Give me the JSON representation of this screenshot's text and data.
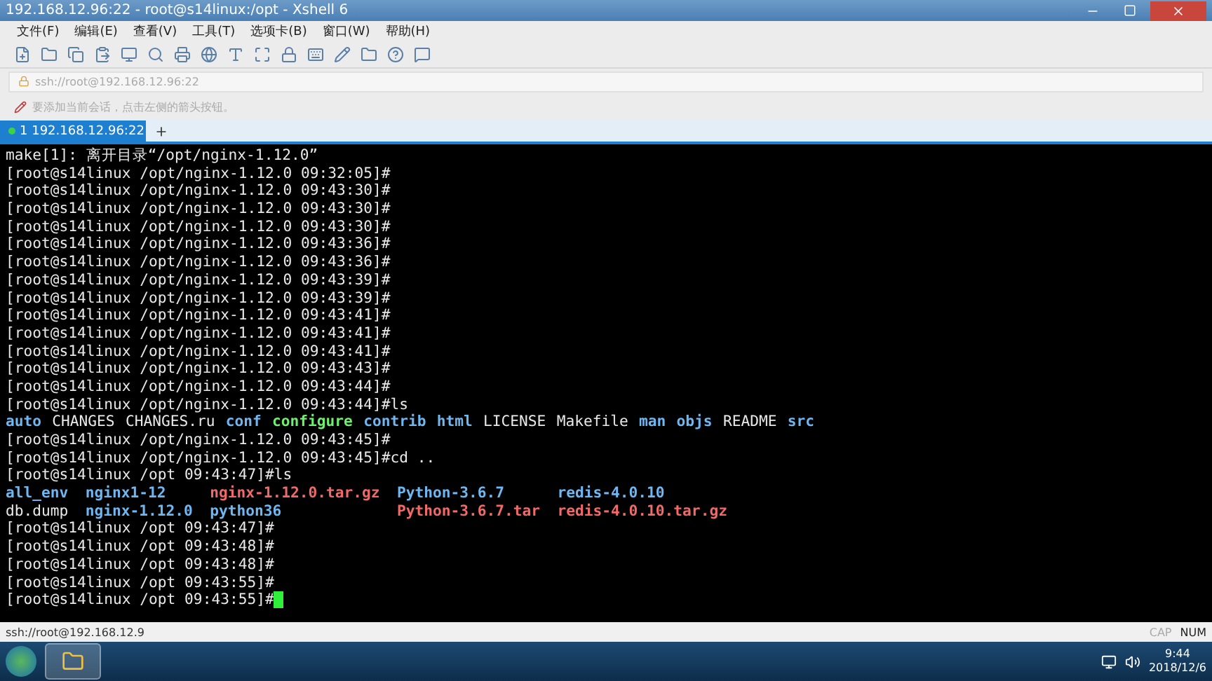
{
  "window": {
    "title": "192.168.12.96:22 - root@s14linux:/opt - Xshell 6"
  },
  "menu": [
    "文件(F)",
    "编辑(E)",
    "查看(V)",
    "工具(T)",
    "选项卡(B)",
    "窗口(W)",
    "帮助(H)"
  ],
  "address": {
    "value": "ssh://root@192.168.12.96:22"
  },
  "hint": "要添加当前会话，点击左侧的箭头按钮。",
  "tabs": [
    {
      "label": "1 192.168.12.96:22",
      "selected": true,
      "connected": true
    }
  ],
  "terminal": {
    "lines": [
      {
        "kind": "text",
        "text": "make[1]: 离开目录“/opt/nginx-1.12.0”"
      },
      {
        "kind": "text",
        "text": "[root@s14linux /opt/nginx-1.12.0 09:32:05]#"
      },
      {
        "kind": "text",
        "text": "[root@s14linux /opt/nginx-1.12.0 09:43:30]#"
      },
      {
        "kind": "text",
        "text": "[root@s14linux /opt/nginx-1.12.0 09:43:30]#"
      },
      {
        "kind": "text",
        "text": "[root@s14linux /opt/nginx-1.12.0 09:43:30]#"
      },
      {
        "kind": "text",
        "text": "[root@s14linux /opt/nginx-1.12.0 09:43:36]#"
      },
      {
        "kind": "text",
        "text": "[root@s14linux /opt/nginx-1.12.0 09:43:36]#"
      },
      {
        "kind": "text",
        "text": "[root@s14linux /opt/nginx-1.12.0 09:43:39]#"
      },
      {
        "kind": "text",
        "text": "[root@s14linux /opt/nginx-1.12.0 09:43:39]#"
      },
      {
        "kind": "text",
        "text": "[root@s14linux /opt/nginx-1.12.0 09:43:41]#"
      },
      {
        "kind": "text",
        "text": "[root@s14linux /opt/nginx-1.12.0 09:43:41]#"
      },
      {
        "kind": "text",
        "text": "[root@s14linux /opt/nginx-1.12.0 09:43:41]#"
      },
      {
        "kind": "text",
        "text": "[root@s14linux /opt/nginx-1.12.0 09:43:43]#"
      },
      {
        "kind": "text",
        "text": "[root@s14linux /opt/nginx-1.12.0 09:43:44]#"
      },
      {
        "kind": "text",
        "text": "[root@s14linux /opt/nginx-1.12.0 09:43:44]#ls"
      },
      {
        "kind": "files",
        "files": [
          {
            "name": "auto",
            "kind": "dir"
          },
          {
            "name": "CHANGES",
            "kind": "file"
          },
          {
            "name": "CHANGES.ru",
            "kind": "file"
          },
          {
            "name": "conf",
            "kind": "dir"
          },
          {
            "name": "configure",
            "kind": "exec"
          },
          {
            "name": "contrib",
            "kind": "dir"
          },
          {
            "name": "html",
            "kind": "dir"
          },
          {
            "name": "LICENSE",
            "kind": "file"
          },
          {
            "name": "Makefile",
            "kind": "file"
          },
          {
            "name": "man",
            "kind": "dir"
          },
          {
            "name": "objs",
            "kind": "dir"
          },
          {
            "name": "README",
            "kind": "file"
          },
          {
            "name": "src",
            "kind": "dir"
          }
        ]
      },
      {
        "kind": "text",
        "text": "[root@s14linux /opt/nginx-1.12.0 09:43:45]#"
      },
      {
        "kind": "text",
        "text": "[root@s14linux /opt/nginx-1.12.0 09:43:45]#cd .."
      },
      {
        "kind": "text",
        "text": "[root@s14linux /opt 09:43:47]#ls"
      },
      {
        "kind": "grid",
        "columns": [
          [
            {
              "name": "all_env",
              "kind": "dir"
            },
            {
              "name": "db.dump",
              "kind": "file"
            }
          ],
          [
            {
              "name": "nginx1-12",
              "kind": "dir"
            },
            {
              "name": "nginx-1.12.0",
              "kind": "dir"
            }
          ],
          [
            {
              "name": "nginx-1.12.0.tar.gz",
              "kind": "archive"
            },
            {
              "name": "python36",
              "kind": "dir"
            }
          ],
          [
            {
              "name": "Python-3.6.7",
              "kind": "dir"
            },
            {
              "name": "Python-3.6.7.tar",
              "kind": "archive"
            }
          ],
          [
            {
              "name": "redis-4.0.10",
              "kind": "dir"
            },
            {
              "name": "redis-4.0.10.tar.gz",
              "kind": "archive"
            }
          ]
        ]
      },
      {
        "kind": "text",
        "text": "[root@s14linux /opt 09:43:47]#"
      },
      {
        "kind": "text",
        "text": "[root@s14linux /opt 09:43:48]#"
      },
      {
        "kind": "text",
        "text": "[root@s14linux /opt 09:43:48]#"
      },
      {
        "kind": "text",
        "text": "[root@s14linux /opt 09:43:55]#"
      },
      {
        "kind": "text",
        "text": "[root@s14linux /opt 09:43:55]#",
        "cursor": true
      }
    ]
  },
  "status_bar": {
    "connection": "ssh://root@192.168.12.9",
    "indicators": [
      {
        "label": "CAP",
        "on": false
      },
      {
        "label": "NUM",
        "on": true
      }
    ]
  },
  "taskbar": {
    "time": "9:44",
    "date": "2018/12/6"
  }
}
